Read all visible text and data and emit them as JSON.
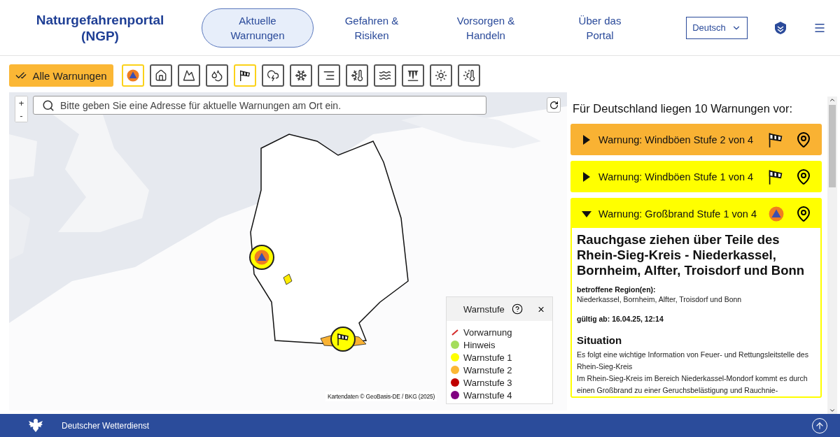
{
  "header": {
    "logo": "Naturgefahrenportal (NGP)",
    "nav": [
      {
        "label": "Aktuelle Warnungen",
        "selected": true
      },
      {
        "label": "Gefahren & Risiken",
        "selected": false
      },
      {
        "label": "Vorsorgen & Handeln",
        "selected": false
      },
      {
        "label": "Über das Portal",
        "selected": false
      }
    ],
    "language": "Deutsch"
  },
  "filters": {
    "all_label": "Alle Warnungen",
    "items": [
      {
        "selected": true
      },
      {
        "selected": false
      },
      {
        "selected": false
      },
      {
        "selected": false
      },
      {
        "selected": true
      },
      {
        "selected": false
      },
      {
        "selected": false
      },
      {
        "selected": false
      },
      {
        "selected": false
      },
      {
        "selected": false
      },
      {
        "selected": false
      },
      {
        "selected": false
      },
      {
        "selected": false
      }
    ]
  },
  "map": {
    "zoom_in": "+",
    "zoom_out": "-",
    "search": {
      "placeholder": "Bitte geben Sie eine Adresse für aktuelle Warnungen am Ort ein."
    },
    "attribution": "Kartendaten © GeoBasis-DE / BKG (2025)",
    "legend": {
      "title": "Warnstufe",
      "items": [
        {
          "label": "Vorwarnung",
          "kind": "stroke",
          "color": "#d42a2a"
        },
        {
          "label": "Hinweis",
          "kind": "dot",
          "color": "#a4dd5c"
        },
        {
          "label": "Warnstufe 1",
          "kind": "dot",
          "color": "#ffff00"
        },
        {
          "label": "Warnstufe 2",
          "kind": "dot",
          "color": "#fbb735"
        },
        {
          "label": "Warnstufe 3",
          "kind": "dot",
          "color": "#c00000"
        },
        {
          "label": "Warnstufe 4",
          "kind": "dot",
          "color": "#800080"
        }
      ]
    }
  },
  "warnings": {
    "heading": "Für Deutschland liegen 10 Warnungen vor:",
    "items": [
      {
        "title": "Warnung: Windböen Stufe 2 von 4",
        "kind": "wind",
        "color": "#f9b233",
        "expanded": false
      },
      {
        "title": "Warnung: Windböen Stufe 1 von 4",
        "kind": "wind",
        "color": "#ffff00",
        "expanded": false
      },
      {
        "title": "Warnung: Großbrand Stufe 1 von 4",
        "kind": "fire",
        "color": "#ffff00",
        "expanded": true,
        "detail": {
          "headline": "Rauchgase ziehen über Teile des Rhein-Sieg-Kreis - Niederkassel, Bornheim, Alfter, Troisdorf und Bonn",
          "region_label": "betroffene Region(en):",
          "region": "Niederkassel, Bornheim, Alfter, Troisdorf und Bonn",
          "valid": "gültig ab: 16.04.25, 12:14",
          "section": "Situation",
          "paragraphs": [
            "Es folgt eine wichtige Information von Feuer- und Rettungsleitstelle des Rhein-Sieg-Kreis",
            "Im Rhein-Sieg-Kreis im Bereich Niederkassel-Mondorf kommt es durch einen Großbrand zu einer Geruchsbelästigung und Rauchnie-"
          ]
        }
      }
    ]
  },
  "footer": {
    "label": "Deutscher Wetterdienst"
  }
}
